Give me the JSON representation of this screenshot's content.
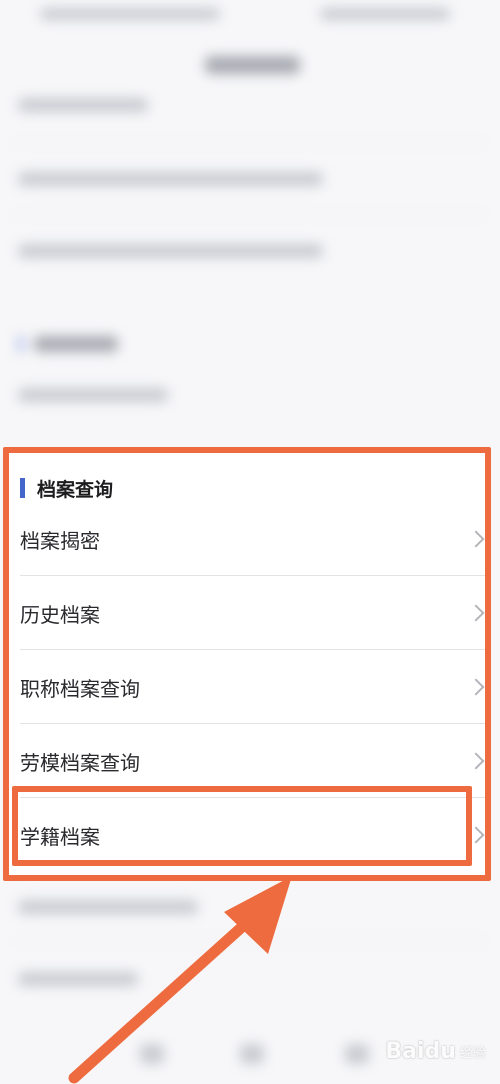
{
  "section": {
    "title": "档案查询"
  },
  "items": [
    {
      "label": "档案揭密"
    },
    {
      "label": "历史档案"
    },
    {
      "label": "职称档案查询"
    },
    {
      "label": "劳模档案查询"
    },
    {
      "label": "学籍档案"
    }
  ],
  "highlight": {
    "color": "#ee6b3f",
    "target_item": "学籍档案"
  },
  "colors": {
    "accent": "#4466cc",
    "annotation": "#ee6b3f"
  },
  "watermark": {
    "brand": "Baidu",
    "suffix": "经验"
  }
}
